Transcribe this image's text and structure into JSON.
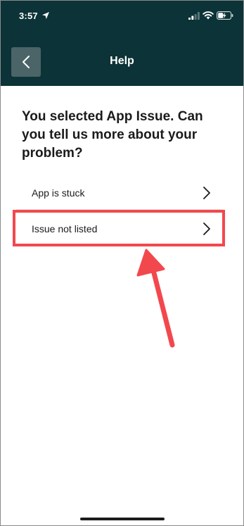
{
  "status_bar": {
    "time": "3:57"
  },
  "header": {
    "title": "Help"
  },
  "question": "You selected App Issue. Can you tell us more about your problem?",
  "options": [
    {
      "label": "App is stuck"
    },
    {
      "label": "Issue not listed"
    }
  ],
  "colors": {
    "header_bg": "#0c3337",
    "back_button_bg": "#4b6467",
    "annotation_red": "#f2484d",
    "text": "#1b1b1b"
  },
  "icons": {
    "back": "chevron-left-icon",
    "option_arrow": "chevron-right-icon",
    "location": "location-arrow-icon",
    "signal": "cellular-signal-icon",
    "wifi": "wifi-icon",
    "battery": "battery-charging-icon"
  }
}
